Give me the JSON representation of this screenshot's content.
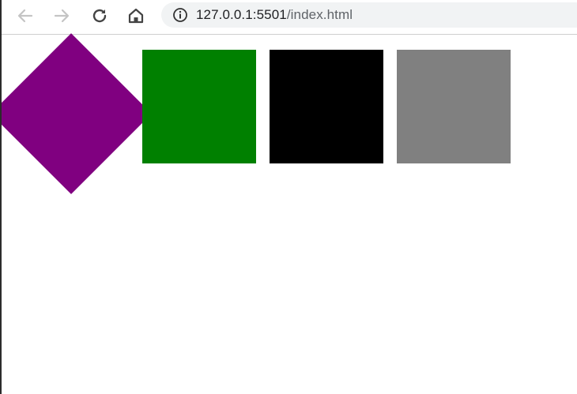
{
  "browser": {
    "url_host": "127.0.0.1:5501",
    "url_path": "/index.html",
    "icons": {
      "back": "arrow-left-icon",
      "forward": "arrow-right-icon",
      "reload": "reload-icon",
      "home": "home-icon",
      "info": "info-icon"
    }
  },
  "page": {
    "shapes": [
      {
        "name": "purple-diamond",
        "color": "#800080",
        "rotated_deg": 45
      },
      {
        "name": "green-square",
        "color": "#008000"
      },
      {
        "name": "black-square",
        "color": "#000000"
      },
      {
        "name": "gray-square",
        "color": "#808080"
      }
    ]
  }
}
